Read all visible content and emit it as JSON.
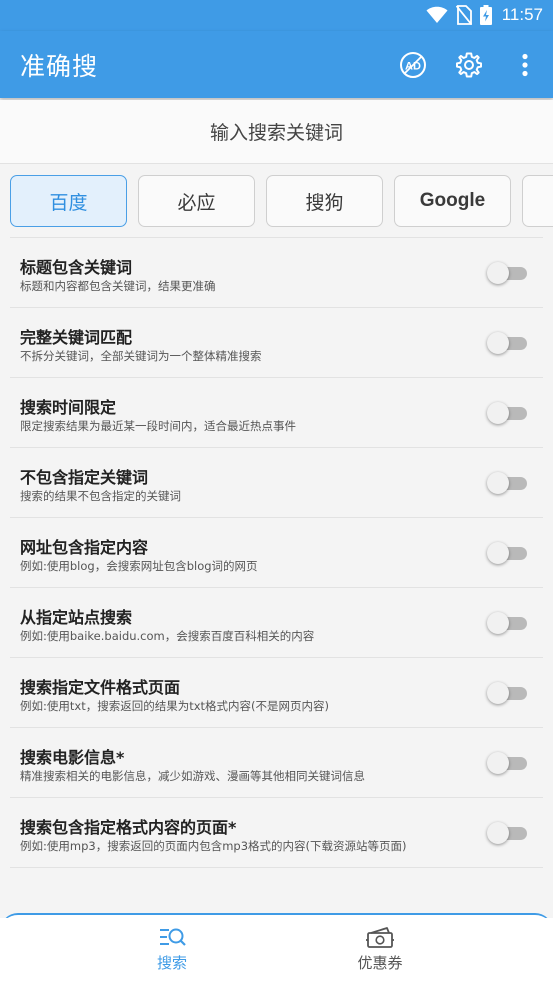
{
  "status_bar": {
    "time": "11:57"
  },
  "app_bar": {
    "title": "准确搜",
    "icons": [
      "ad-block-icon",
      "gear-icon",
      "more-vert-icon"
    ]
  },
  "search": {
    "placeholder": "输入搜索关键词"
  },
  "engines": [
    {
      "label": "百度",
      "active": true
    },
    {
      "label": "必应",
      "active": false
    },
    {
      "label": "搜狗",
      "active": false
    },
    {
      "label": "Google",
      "active": false
    },
    {
      "label": "",
      "active": false
    }
  ],
  "options": [
    {
      "title": "标题包含关键词",
      "desc": "标题和内容都包含关键词，结果更准确",
      "enabled": false
    },
    {
      "title": "完整关键词匹配",
      "desc": "不拆分关键词，全部关键词为一个整体精准搜索",
      "enabled": false
    },
    {
      "title": "搜索时间限定",
      "desc": "限定搜索结果为最近某一段时间内，适合最近热点事件",
      "enabled": false
    },
    {
      "title": "不包含指定关键词",
      "desc": "搜索的结果不包含指定的关键词",
      "enabled": false
    },
    {
      "title": "网址包含指定内容",
      "desc": "例如:使用blog，会搜索网址包含blog词的网页",
      "enabled": false
    },
    {
      "title": "从指定站点搜索",
      "desc": "例如:使用baike.baidu.com，会搜索百度百科相关的内容",
      "enabled": false
    },
    {
      "title": "搜索指定文件格式页面",
      "desc": "例如:使用txt，搜索返回的结果为txt格式内容(不是网页内容)",
      "enabled": false
    },
    {
      "title": "搜索电影信息*",
      "desc": "精准搜索相关的电影信息，减少如游戏、漫画等其他相同关键词信息",
      "enabled": false
    },
    {
      "title": "搜索包含指定格式内容的页面*",
      "desc": "例如:使用mp3，搜索返回的页面内包含mp3格式的内容(下载资源站等页面)",
      "enabled": false
    }
  ],
  "bottom_nav": [
    {
      "label": "搜索",
      "icon": "search-list-icon",
      "active": true
    },
    {
      "label": "优惠券",
      "icon": "coupon-icon",
      "active": false
    }
  ],
  "colors": {
    "primary": "#3f9be6",
    "active_tab_bg": "#e3f0fc",
    "background": "#f4f4f4"
  }
}
